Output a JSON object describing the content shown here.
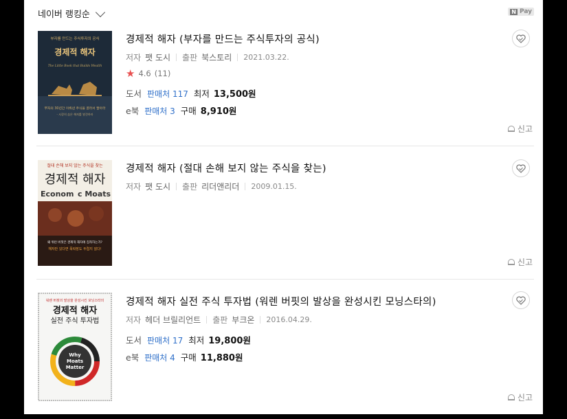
{
  "sort": {
    "label": "네이버 랭킹순"
  },
  "npay": {
    "n": "N",
    "label": "Pay"
  },
  "books": [
    {
      "title": "경제적 해자 (부자를 만드는 주식투자의 공식)",
      "author_label": "저자",
      "author": "팻 도시",
      "publisher_label": "출판",
      "publisher": "북스토리",
      "date": "2021.03.22.",
      "rating": "4.6",
      "rating_count": "(11)",
      "book": {
        "kind": "도서",
        "sellers": "판매처 117",
        "price_label": "최저",
        "price": "13,500",
        "unit": "원"
      },
      "ebook": {
        "kind": "e북",
        "sellers": "판매처 3",
        "price_label": "구매",
        "price": "8,910",
        "unit": "원"
      },
      "report": "신고",
      "cover": {
        "top_text": "부자를 만드는 주식투자의 공식",
        "title": "경제적 해자",
        "eng": "The Little Book that Builds Wealth",
        "mid": "부자의 30년간 이뤄낸 주식을 골라서 팔아라",
        "sub": "- 시장의 숨은 해자를 발견하라"
      }
    },
    {
      "title": "경제적 해자 (절대 손해 보지 않는 주식을 찾는)",
      "author_label": "저자",
      "author": "팻 도시",
      "publisher_label": "출판",
      "publisher": "리더앤리더",
      "date": "2009.01.15.",
      "report": "신고",
      "cover": {
        "top_text": "절대 손해 보지 않는 주식을 찾는",
        "title": "경제적 해자",
        "eng1": "Econom",
        "eng2": "c Moats",
        "band1": "왜 위런 버핏은 경제적 해자에 집착하는가?",
        "band2": "해자만 있다면 폭락장도 두렵지 않다!"
      }
    },
    {
      "title": "경제적 해자 실전 주식 투자법 (워렌 버핏의 발상을 완성시킨 모닝스타의)",
      "author_label": "저자",
      "author": "헤더 브릴리언트",
      "publisher_label": "출판",
      "publisher": "부크온",
      "date": "2016.04.29.",
      "book": {
        "kind": "도서",
        "sellers": "판매처 17",
        "price_label": "최저",
        "price": "19,800",
        "unit": "원"
      },
      "ebook": {
        "kind": "e북",
        "sellers": "판매처 4",
        "price_label": "구매",
        "price": "11,880",
        "unit": "원"
      },
      "report": "신고",
      "cover": {
        "top_text": "워렌 버핏의 발상을 완성시킨 모닝스타의",
        "title1": "경제적 해자",
        "title2": "실전 주식 투자법",
        "ring1": "Why",
        "ring2": "Moats",
        "ring3": "Matter"
      }
    }
  ]
}
